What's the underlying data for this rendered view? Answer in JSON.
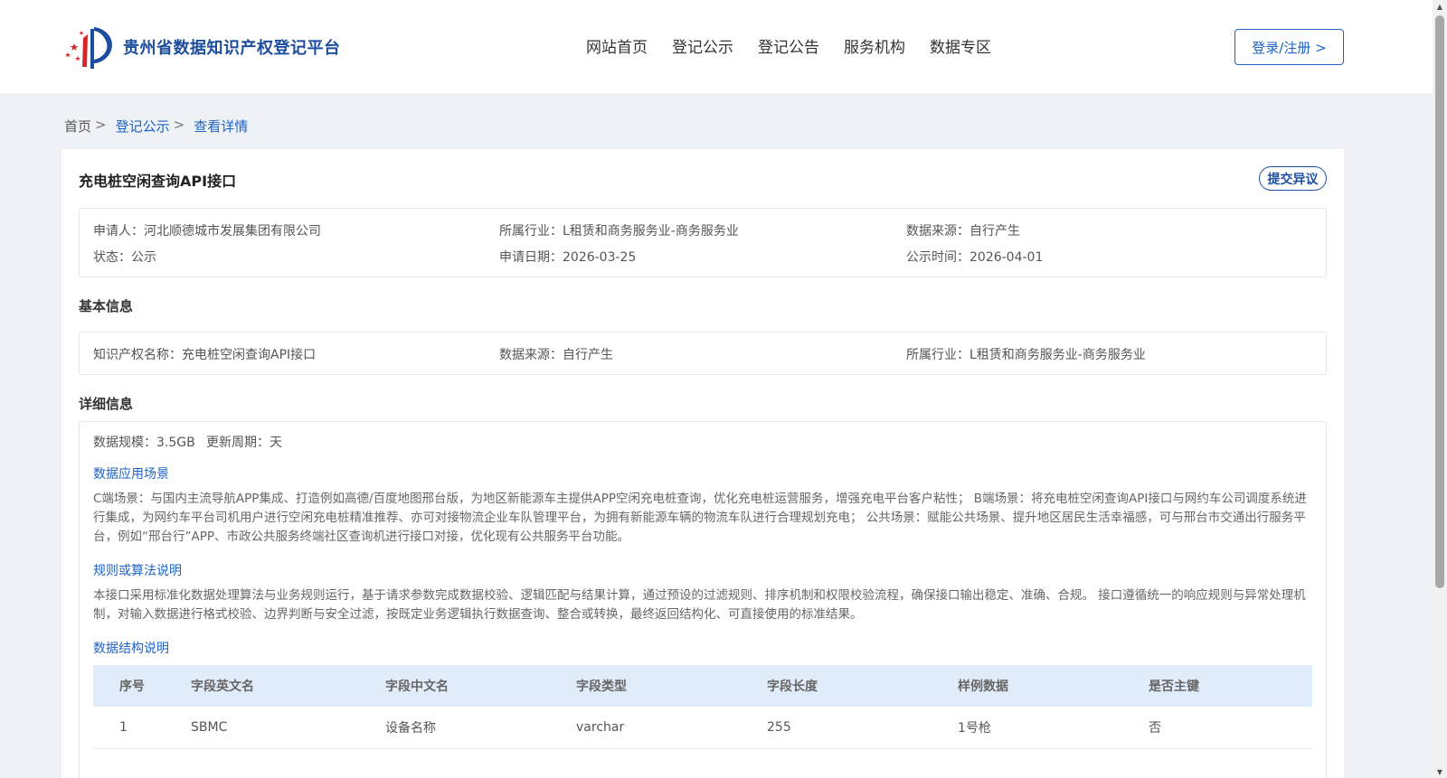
{
  "header": {
    "logo_text": "贵州省数据知识产权登记平台",
    "nav": [
      "网站首页",
      "登记公示",
      "登记公告",
      "服务机构",
      "数据专区"
    ],
    "login_label": "登录/注册 >"
  },
  "breadcrumb": {
    "home": "首页",
    "section": "登记公示",
    "current": "查看详情",
    "sep": ">"
  },
  "detail": {
    "title": "充电桩空闲查询API接口",
    "objection_label": "提交异议",
    "summary": {
      "applicant_label": "申请人：",
      "applicant": "河北顺德城市发展集团有限公司",
      "industry_label": "所属行业：",
      "industry": "L租赁和商务服务业-商务服务业",
      "source_label": "数据来源：",
      "source": "自行产生",
      "status_label": "状态：",
      "status": "公示",
      "apply_date_label": "申请日期：",
      "apply_date": "2026-03-25",
      "publish_label": "公示时间：",
      "publish": "2026-04-01"
    },
    "basic": {
      "section_title": "基本信息",
      "ip_name_label": "知识产权名称：",
      "ip_name": "充电桩空闲查询API接口",
      "source_label": "数据来源：",
      "source": "自行产生",
      "industry_label": "所属行业：",
      "industry": "L租赁和商务服务业-商务服务业"
    },
    "info": {
      "section_title": "详细信息",
      "scale_label": "数据规模：",
      "scale": "3.5GB",
      "cycle_label": "更新周期：",
      "cycle": "天",
      "scenario_title": "数据应用场景",
      "scenario_text": "C端场景：与国内主流导航APP集成、打造例如高德/百度地图邢台版，为地区新能源车主提供APP空闲充电桩查询，优化充电桩运营服务，增强充电平台客户粘性； B端场景：将充电桩空闲查询API接口与网约车公司调度系统进行集成，为网约车平台司机用户进行空闲充电桩精准推荐、亦可对接物流企业车队管理平台，为拥有新能源车辆的物流车队进行合理规划充电； 公共场景：赋能公共场景、提升地区居民生活幸福感，可与邢台市交通出行服务平台，例如“邢台行”APP、市政公共服务终端社区查询机进行接口对接，优化现有公共服务平台功能。",
      "algo_title": "规则或算法说明",
      "algo_text": "本接口采用标准化数据处理算法与业务规则运行，基于请求参数完成数据校验、逻辑匹配与结果计算，通过预设的过滤规则、排序机制和权限校验流程，确保接口输出稳定、准确、合规。 接口遵循统一的响应规则与异常处理机制，对输入数据进行格式校验、边界判断与安全过滤，按既定业务逻辑执行数据查询、整合或转换，最终返回结构化、可直接使用的标准结果。",
      "structure_title": "数据结构说明"
    },
    "table": {
      "columns": [
        "序号",
        "字段英文名",
        "字段中文名",
        "字段类型",
        "字段长度",
        "样例数据",
        "是否主键"
      ],
      "rows": [
        [
          "1",
          "SBMC",
          "设备名称",
          "varchar",
          "255",
          "1号枪",
          "否"
        ]
      ]
    }
  },
  "colors": {
    "brand": "#1d4e9e",
    "link": "#1f63c4",
    "table_header_bg": "#e1ecfa",
    "page_bg": "#eef1f5"
  }
}
